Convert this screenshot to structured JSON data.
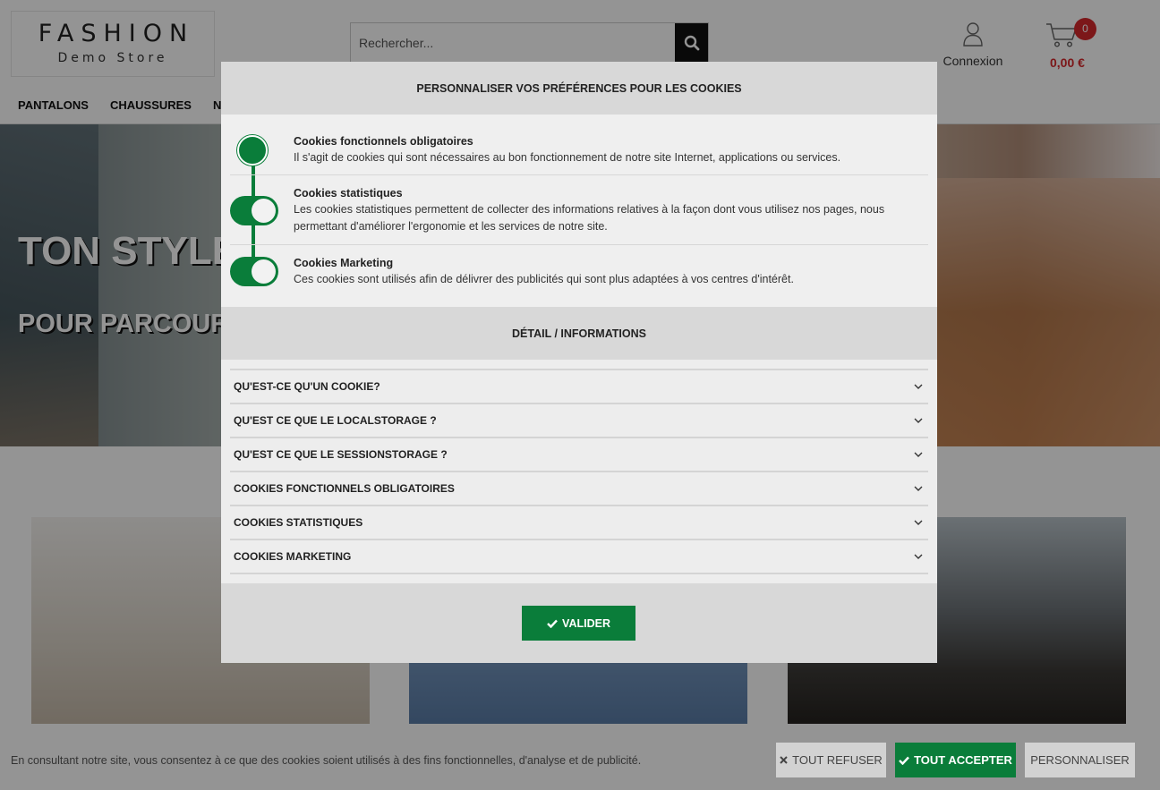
{
  "header": {
    "logo_main": "FASHION",
    "logo_sub": "Demo Store",
    "search_placeholder": "Rechercher...",
    "account_label": "Connexion",
    "cart_count": "0",
    "cart_total": "0,00 €"
  },
  "nav": {
    "items": [
      {
        "label": "PANTALONS"
      },
      {
        "label": "CHAUSSURES"
      },
      {
        "label": "NO"
      }
    ]
  },
  "hero": {
    "title": "TON STYLE",
    "subtitle": "POUR PARCOUR"
  },
  "modal": {
    "title": "PERSONNALISER VOS PRÉFÉRENCES POUR LES COOKIES",
    "preferences": [
      {
        "title": "Cookies fonctionnels obligatoires",
        "description": "Il s'agit de cookies qui sont nécessaires au bon fonctionnement de notre site Internet, applications ou services.",
        "enabled": true,
        "locked": true
      },
      {
        "title": "Cookies statistiques",
        "description": "Les cookies statistiques permettent de collecter des informations relatives à la façon dont vous utilisez nos pages, nous permettant d'améliorer l'ergonomie et les services de notre site.",
        "enabled": true
      },
      {
        "title": "Cookies Marketing",
        "description": "Ces cookies sont utilisés afin de délivrer des publicités qui sont plus adaptées à vos centres d'intérêt.",
        "enabled": true
      }
    ],
    "detail_title": "DÉTAIL / INFORMATIONS",
    "accordion": [
      {
        "label": "QU'EST-CE QU'UN COOKIE?"
      },
      {
        "label": "QU'EST CE QUE LE LOCALSTORAGE ?"
      },
      {
        "label": "QU'EST CE QUE LE SESSIONSTORAGE ?"
      },
      {
        "label": "COOKIES FONCTIONNELS OBLIGATOIRES"
      },
      {
        "label": "COOKIES STATISTIQUES"
      },
      {
        "label": "COOKIES MARKETING"
      }
    ],
    "validate_label": "VALIDER"
  },
  "banner": {
    "text": "En consultant notre site, vous consentez à ce que des cookies soient utilisés à des fins fonctionnelles, d'analyse et de publicité.",
    "refuse_label": "TOUT REFUSER",
    "accept_label": "TOUT ACCEPTER",
    "customize_label": "PERSONNALISER"
  },
  "colors": {
    "accent_green": "#0a7d3a",
    "cart_red": "#d6282c",
    "overlay": "rgba(0,0,0,0.42)"
  },
  "icons": [
    "search-icon",
    "user-icon",
    "cart-icon",
    "chevron-down-icon",
    "check-icon",
    "close-icon"
  ]
}
